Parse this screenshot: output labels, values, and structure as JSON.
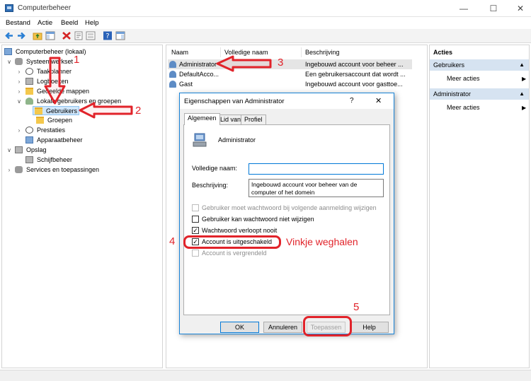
{
  "window": {
    "title": "Computerbeheer"
  },
  "menu": [
    "Bestand",
    "Actie",
    "Beeld",
    "Help"
  ],
  "tree": {
    "items": [
      "Computerbeheer (lokaal)",
      "Systeemwerkset",
      "Taakplanner",
      "Logboeken",
      "Gedeelde mappen",
      "Lokale gebruikers en groepen",
      "Gebruikers",
      "Groepen",
      "Prestaties",
      "Apparaatbeheer",
      "Opslag",
      "Schijfbeheer",
      "Services en toepassingen"
    ]
  },
  "list": {
    "columns": [
      "Naam",
      "Volledige naam",
      "Beschrijving"
    ],
    "rows": [
      {
        "name": "Administrator",
        "fullname": "",
        "desc": "Ingebouwd account voor beheer ..."
      },
      {
        "name": "DefaultAcco...",
        "fullname": "",
        "desc": "Een gebruikersaccount dat wordt ..."
      },
      {
        "name": "Gast",
        "fullname": "",
        "desc": "Ingebouwd account voor gasttoe..."
      }
    ]
  },
  "actions": {
    "sections": [
      {
        "title": "Acties",
        "items": []
      },
      {
        "title": "Gebruikers",
        "items": [
          "Meer acties"
        ]
      },
      {
        "title": "Administrator",
        "items": [
          "Meer acties"
        ]
      }
    ]
  },
  "dialog": {
    "title": "Eigenschappen van Administrator",
    "help": "?",
    "tabs": [
      "Algemeen",
      "Lid van",
      "Profiel"
    ],
    "username": "Administrator",
    "fullname_label": "Volledige naam:",
    "fullname_value": "",
    "desc_label": "Beschrijving:",
    "desc_value": "Ingebouwd account voor beheer van de computer of het domein",
    "checkboxes": [
      {
        "label": "Gebruiker moet wachtwoord bij volgende aanmelding wijzigen",
        "checked": false,
        "enabled": false
      },
      {
        "label": "Gebruiker kan wachtwoord niet wijzigen",
        "checked": false,
        "enabled": true
      },
      {
        "label": "Wachtwoord verloopt nooit",
        "checked": true,
        "enabled": true
      },
      {
        "label": "Account is uitgeschakeld",
        "checked": true,
        "enabled": true
      },
      {
        "label": "Account is vergrendeld",
        "checked": false,
        "enabled": false
      }
    ],
    "buttons": [
      "OK",
      "Annuleren",
      "Toepassen",
      "Help"
    ]
  },
  "annotations": {
    "numbers": [
      "1",
      "2",
      "3",
      "4",
      "5"
    ],
    "note": "Vinkje weghalen",
    "color": "#e1232a"
  },
  "icons": [
    "app-icon",
    "back-arrow-icon",
    "forward-arrow-icon",
    "folder-up-icon",
    "show-hide-tree-icon",
    "delete-icon",
    "properties-icon",
    "export-icon",
    "help-icon",
    "action-pane-icon",
    "user-icon",
    "check-icon"
  ]
}
